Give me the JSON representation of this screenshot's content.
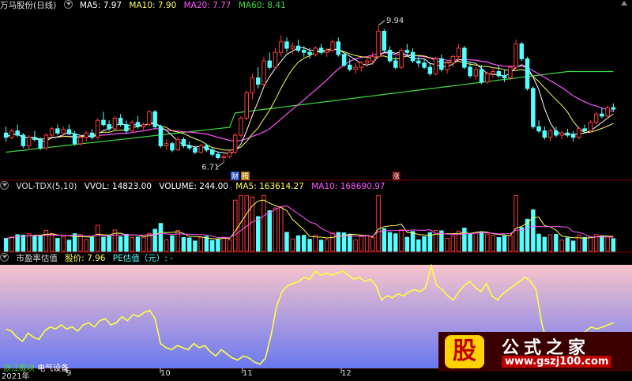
{
  "main_header": {
    "stock": "万马股份(日线)",
    "ma5": "MA5: 7.97",
    "ma10": "MA10: 7.90",
    "ma20": "MA20: 7.77",
    "ma60": "MA60: 8.41"
  },
  "vol_header": {
    "name": "VOL-TDX(5,10)",
    "vvol": "VVOL: 14823.00",
    "volume": "VOLUME: 244.00",
    "ma5": "MA5: 163614.27",
    "ma10": "MA10: 168690.97"
  },
  "pe_header": {
    "name": "市盈率估值",
    "price": "股价: 7.96",
    "pe": "PE估值（元）: -"
  },
  "annotations": {
    "high": "9.94",
    "low": "6.71",
    "tag1": "财",
    "tag2": "腾",
    "tag3": "涨"
  },
  "bottom_labels": {
    "sector_tag": "电气设备",
    "sector_prefix": "浙江板块"
  },
  "x_labels": [
    "2021年",
    "9",
    "10",
    "11",
    "12"
  ],
  "watermark": {
    "seal": "股",
    "title": "公式之家",
    "url": "www.gszj100.com"
  },
  "colors": {
    "up": "#ff3b3b",
    "down": "#54ffff",
    "ma5": "#ffffff",
    "ma10": "#ffff55",
    "ma20": "#ff55ff",
    "ma60": "#3fdc3f",
    "pe_line": "#ffff40"
  },
  "chart_data": [
    {
      "type": "candlestick",
      "title": "万马股份(日线)",
      "ylim": [
        6.4,
        10.2
      ],
      "candles": [
        [
          7.4,
          7.55,
          7.2,
          7.3
        ],
        [
          7.3,
          7.5,
          7.25,
          7.45
        ],
        [
          7.45,
          7.6,
          7.3,
          7.35
        ],
        [
          7.35,
          7.4,
          7.05,
          7.1
        ],
        [
          7.1,
          7.35,
          7.0,
          7.3
        ],
        [
          7.3,
          7.45,
          7.2,
          7.25
        ],
        [
          7.25,
          7.3,
          7.0,
          7.05
        ],
        [
          7.05,
          7.4,
          7.0,
          7.35
        ],
        [
          7.35,
          7.55,
          7.3,
          7.5
        ],
        [
          7.5,
          7.6,
          7.35,
          7.4
        ],
        [
          7.4,
          7.55,
          7.3,
          7.48
        ],
        [
          7.48,
          7.6,
          7.35,
          7.38
        ],
        [
          7.38,
          7.45,
          7.1,
          7.15
        ],
        [
          7.15,
          7.35,
          7.1,
          7.3
        ],
        [
          7.3,
          7.45,
          7.2,
          7.4
        ],
        [
          7.4,
          7.5,
          7.25,
          7.3
        ],
        [
          7.3,
          7.75,
          7.25,
          7.7
        ],
        [
          7.7,
          7.9,
          7.55,
          7.6
        ],
        [
          7.6,
          7.7,
          7.45,
          7.5
        ],
        [
          7.5,
          7.8,
          7.45,
          7.75
        ],
        [
          7.75,
          7.85,
          7.55,
          7.6
        ],
        [
          7.6,
          7.7,
          7.4,
          7.45
        ],
        [
          7.45,
          7.7,
          7.4,
          7.65
        ],
        [
          7.65,
          7.8,
          7.5,
          7.55
        ],
        [
          7.55,
          7.65,
          7.45,
          7.6
        ],
        [
          7.6,
          7.95,
          7.55,
          7.9
        ],
        [
          7.9,
          7.95,
          7.5,
          7.55
        ],
        [
          7.55,
          7.6,
          7.05,
          7.1
        ],
        [
          7.1,
          7.25,
          7.0,
          7.15
        ],
        [
          7.15,
          7.2,
          6.95,
          7.0
        ],
        [
          7.0,
          7.3,
          6.98,
          7.25
        ],
        [
          7.25,
          7.3,
          7.05,
          7.1
        ],
        [
          7.1,
          7.2,
          7.0,
          7.05
        ],
        [
          7.05,
          7.1,
          6.9,
          6.95
        ],
        [
          6.95,
          7.15,
          6.92,
          7.1
        ],
        [
          7.1,
          7.15,
          6.95,
          7.0
        ],
        [
          7.0,
          7.05,
          6.85,
          6.9
        ],
        [
          6.9,
          6.95,
          6.78,
          6.82
        ],
        [
          6.82,
          6.9,
          6.71,
          6.85
        ],
        [
          6.85,
          7.0,
          6.8,
          6.95
        ],
        [
          6.95,
          7.4,
          6.9,
          7.35
        ],
        [
          7.35,
          7.8,
          7.3,
          7.75
        ],
        [
          7.75,
          8.4,
          7.7,
          8.35
        ],
        [
          8.35,
          8.8,
          8.2,
          8.7
        ],
        [
          8.7,
          8.95,
          8.45,
          8.55
        ],
        [
          8.55,
          9.2,
          8.5,
          9.1
        ],
        [
          9.1,
          9.3,
          8.9,
          8.95
        ],
        [
          8.95,
          9.4,
          8.9,
          9.3
        ],
        [
          9.3,
          9.7,
          9.2,
          9.55
        ],
        [
          9.55,
          9.65,
          9.3,
          9.4
        ],
        [
          9.4,
          9.55,
          9.25,
          9.45
        ],
        [
          9.45,
          9.6,
          9.3,
          9.35
        ],
        [
          9.35,
          9.45,
          9.2,
          9.3
        ],
        [
          9.3,
          9.4,
          9.15,
          9.25
        ],
        [
          9.25,
          9.45,
          9.2,
          9.4
        ],
        [
          9.4,
          9.5,
          9.25,
          9.3
        ],
        [
          9.3,
          9.4,
          9.2,
          9.35
        ],
        [
          9.35,
          9.6,
          9.3,
          9.55
        ],
        [
          9.55,
          9.65,
          9.2,
          9.25
        ],
        [
          9.25,
          9.3,
          8.95,
          9.0
        ],
        [
          9.0,
          9.15,
          8.85,
          8.9
        ],
        [
          8.9,
          9.05,
          8.8,
          8.95
        ],
        [
          8.95,
          9.1,
          8.85,
          9.05
        ],
        [
          9.05,
          9.2,
          8.95,
          9.1
        ],
        [
          9.1,
          9.3,
          9.0,
          9.2
        ],
        [
          9.2,
          9.94,
          9.15,
          9.8
        ],
        [
          9.8,
          9.85,
          9.3,
          9.35
        ],
        [
          9.35,
          9.45,
          9.05,
          9.1
        ],
        [
          9.1,
          9.2,
          8.9,
          8.95
        ],
        [
          8.95,
          9.4,
          8.9,
          9.35
        ],
        [
          9.35,
          9.5,
          9.2,
          9.3
        ],
        [
          9.3,
          9.4,
          9.05,
          9.1
        ],
        [
          9.1,
          9.2,
          8.95,
          9.05
        ],
        [
          9.05,
          9.15,
          8.9,
          8.95
        ],
        [
          8.95,
          9.05,
          8.75,
          8.8
        ],
        [
          8.8,
          9.2,
          8.75,
          9.15
        ],
        [
          9.15,
          9.25,
          8.85,
          8.9
        ],
        [
          8.9,
          9.1,
          8.8,
          9.05
        ],
        [
          9.05,
          9.25,
          8.95,
          9.2
        ],
        [
          9.2,
          9.5,
          9.1,
          9.4
        ],
        [
          9.4,
          9.45,
          8.9,
          8.95
        ],
        [
          8.95,
          9.05,
          8.7,
          8.75
        ],
        [
          8.75,
          8.95,
          8.65,
          8.9
        ],
        [
          8.9,
          9.0,
          8.55,
          8.6
        ],
        [
          8.6,
          8.85,
          8.55,
          8.8
        ],
        [
          8.8,
          8.95,
          8.7,
          8.85
        ],
        [
          8.85,
          9.0,
          8.7,
          8.75
        ],
        [
          8.75,
          8.9,
          8.6,
          8.7
        ],
        [
          8.7,
          9.0,
          8.65,
          8.95
        ],
        [
          8.95,
          9.6,
          8.9,
          9.5
        ],
        [
          9.5,
          9.55,
          9.1,
          9.15
        ],
        [
          9.15,
          9.2,
          8.4,
          8.45
        ],
        [
          8.45,
          8.5,
          7.5,
          7.55
        ],
        [
          7.55,
          7.7,
          7.4,
          7.45
        ],
        [
          7.45,
          7.55,
          7.25,
          7.3
        ],
        [
          7.3,
          7.5,
          7.2,
          7.45
        ],
        [
          7.45,
          7.55,
          7.3,
          7.35
        ],
        [
          7.35,
          7.45,
          7.25,
          7.4
        ],
        [
          7.4,
          7.5,
          7.3,
          7.35
        ],
        [
          7.35,
          7.45,
          7.2,
          7.3
        ],
        [
          7.3,
          7.55,
          7.25,
          7.5
        ],
        [
          7.5,
          7.6,
          7.4,
          7.45
        ],
        [
          7.45,
          7.7,
          7.4,
          7.65
        ],
        [
          7.65,
          7.9,
          7.6,
          7.85
        ],
        [
          7.85,
          8.0,
          7.75,
          7.8
        ],
        [
          7.8,
          8.05,
          7.75,
          8.0
        ],
        [
          8.0,
          8.1,
          7.9,
          7.96
        ]
      ],
      "ma_series": [
        {
          "name": "MA5",
          "last": 7.97
        },
        {
          "name": "MA10",
          "last": 7.9
        },
        {
          "name": "MA20",
          "last": 7.77
        },
        {
          "name": "MA60",
          "last": 8.41
        }
      ]
    },
    {
      "type": "bar",
      "title": "VOL-TDX(5,10)",
      "ylim": [
        0,
        900000
      ]
    },
    {
      "type": "line",
      "title": "市盈率估值",
      "ylim": [
        0,
        1
      ],
      "values": [
        0.38,
        0.36,
        0.3,
        0.26,
        0.34,
        0.3,
        0.28,
        0.36,
        0.4,
        0.38,
        0.42,
        0.38,
        0.4,
        0.36,
        0.42,
        0.44,
        0.4,
        0.46,
        0.48,
        0.42,
        0.44,
        0.5,
        0.46,
        0.52,
        0.5,
        0.54,
        0.56,
        0.48,
        0.24,
        0.2,
        0.18,
        0.22,
        0.2,
        0.18,
        0.24,
        0.2,
        0.22,
        0.16,
        0.12,
        0.18,
        0.14,
        0.1,
        0.08,
        0.12,
        0.1,
        0.06,
        0.04,
        0.1,
        0.32,
        0.6,
        0.74,
        0.8,
        0.82,
        0.84,
        0.88,
        0.86,
        0.94,
        0.9,
        0.92,
        0.9,
        0.92,
        0.94,
        0.9,
        0.86,
        0.88,
        0.84,
        0.86,
        0.8,
        0.66,
        0.7,
        0.68,
        0.72,
        0.7,
        0.74,
        0.76,
        0.74,
        0.78,
        0.99,
        0.8,
        0.76,
        0.7,
        0.66,
        0.74,
        0.8,
        0.84,
        0.78,
        0.74,
        0.82,
        0.7,
        0.66,
        0.72,
        0.76,
        0.8,
        0.84,
        0.88,
        0.84,
        0.76,
        0.44,
        0.24,
        0.26,
        0.3,
        0.26,
        0.3,
        0.32,
        0.3,
        0.36,
        0.4,
        0.38,
        0.4,
        0.42,
        0.44
      ]
    }
  ]
}
